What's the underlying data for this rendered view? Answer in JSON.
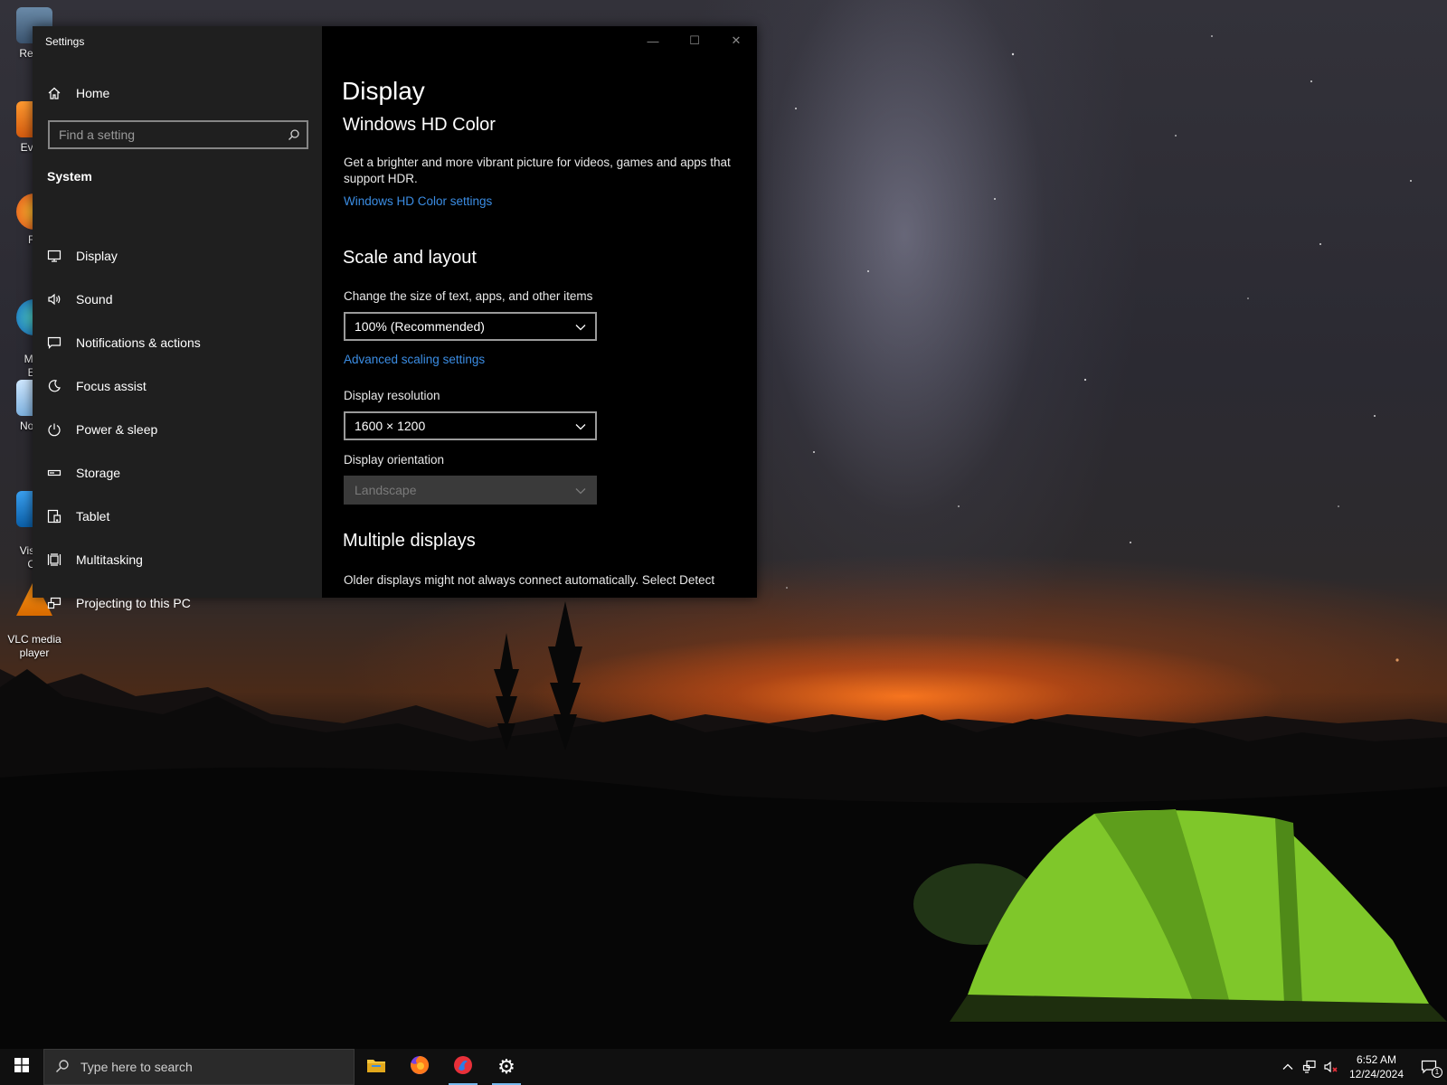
{
  "desktop": {
    "icons": [
      {
        "label": "Recyc",
        "icon": "recycle-bin-icon"
      },
      {
        "label": "Every",
        "icon": "everything-app-icon"
      },
      {
        "label": "Fir",
        "icon": "firefox-desktop-icon"
      },
      {
        "label": "Micr\nEd",
        "icon": "edge-icon"
      },
      {
        "label": "Notep",
        "icon": "notepad-icon"
      },
      {
        "label": "Visual\nCo",
        "icon": "vscode-icon"
      },
      {
        "label": "VLC media\nplayer",
        "icon": "vlc-icon"
      }
    ]
  },
  "window": {
    "title": "Settings",
    "controls": {
      "minimize": "—",
      "maximize": "☐",
      "close": "✕"
    }
  },
  "nav": {
    "home_label": "Home",
    "search_placeholder": "Find a setting",
    "section_label": "System",
    "items": [
      {
        "label": "Display",
        "icon": "monitor-icon"
      },
      {
        "label": "Sound",
        "icon": "speaker-icon"
      },
      {
        "label": "Notifications & actions",
        "icon": "message-icon"
      },
      {
        "label": "Focus assist",
        "icon": "moon-icon"
      },
      {
        "label": "Power & sleep",
        "icon": "power-icon"
      },
      {
        "label": "Storage",
        "icon": "drive-icon"
      },
      {
        "label": "Tablet",
        "icon": "tablet-icon"
      },
      {
        "label": "Multitasking",
        "icon": "multitasking-icon"
      },
      {
        "label": "Projecting to this PC",
        "icon": "projecting-icon"
      }
    ]
  },
  "content": {
    "page_title": "Display",
    "hdr": {
      "heading": "Windows HD Color",
      "description": "Get a brighter and more vibrant picture for videos, games and apps that support HDR.",
      "link": "Windows HD Color settings"
    },
    "scale": {
      "heading": "Scale and layout",
      "size_label": "Change the size of text, apps, and other items",
      "size_value": "100% (Recommended)",
      "advanced_link": "Advanced scaling settings",
      "resolution_label": "Display resolution",
      "resolution_value": "1600 × 1200",
      "orientation_label": "Display orientation",
      "orientation_value": "Landscape"
    },
    "multiple": {
      "heading": "Multiple displays",
      "description": "Older displays might not always connect automatically. Select Detect"
    }
  },
  "taskbar": {
    "search_placeholder": "Type here to search",
    "apps": [
      "file-explorer-icon",
      "firefox-icon",
      "app-icon",
      "settings-gear-icon"
    ],
    "clock_time": "6:52 AM",
    "clock_date": "12/24/2024",
    "notification_count": "1"
  },
  "colors": {
    "accent_link": "#3b8de4",
    "nav_bg": "#1f1f1f",
    "content_bg": "#000000",
    "taskbar_bg": "#101010"
  }
}
